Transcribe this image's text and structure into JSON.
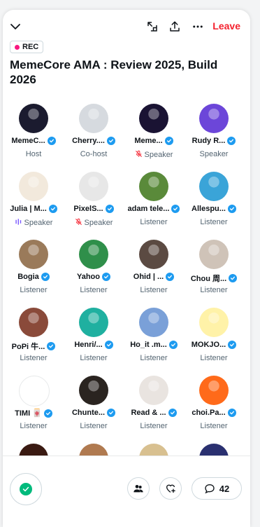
{
  "topbar": {
    "leave_label": "Leave",
    "icons": [
      "chevron-down-icon",
      "dock-icon",
      "share-icon",
      "more-icon"
    ]
  },
  "rec_label": "REC",
  "space_title": "MemeCore AMA : Review 2025, Build 2026",
  "participants": [
    {
      "name": "MemeC...",
      "role": "Host",
      "mic": "none",
      "avatar_color": "#1b1b2f"
    },
    {
      "name": "Cherry....",
      "role": "Co-host",
      "mic": "none",
      "avatar_color": "#d6dadf"
    },
    {
      "name": "Meme...",
      "role": "Speaker",
      "mic": "muted",
      "avatar_color": "#1a1333"
    },
    {
      "name": "Rudy R...",
      "role": "Speaker",
      "mic": "none",
      "avatar_color": "#6c46d9"
    },
    {
      "name": "Julia | M...",
      "role": "Speaker",
      "mic": "speaking",
      "avatar_color": "#f2e9dc"
    },
    {
      "name": "PixelS...",
      "role": "Speaker",
      "mic": "muted",
      "avatar_color": "#e7e7e7"
    },
    {
      "name": "adam tele...",
      "role": "Listener",
      "mic": "none",
      "avatar_color": "#5a8a3a"
    },
    {
      "name": "Allespu...",
      "role": "Listener",
      "mic": "none",
      "avatar_color": "#3aa4d8"
    },
    {
      "name": "Bogia",
      "role": "Listener",
      "mic": "none",
      "avatar_color": "#9a7a5a"
    },
    {
      "name": "Yahoo",
      "role": "Listener",
      "mic": "none",
      "avatar_color": "#2f8f4a"
    },
    {
      "name": "Ohid | ...",
      "role": "Listener",
      "mic": "none",
      "avatar_color": "#5b4a42"
    },
    {
      "name": "Chou 周...",
      "role": "Listener",
      "mic": "none",
      "avatar_color": "#cfc3b8"
    },
    {
      "name": "PoPi 牛...",
      "role": "Listener",
      "mic": "none",
      "avatar_color": "#8a4a3a"
    },
    {
      "name": "Henri/...",
      "role": "Listener",
      "mic": "none",
      "avatar_color": "#1fb0a0"
    },
    {
      "name": "Ho_it .m...",
      "role": "Listener",
      "mic": "none",
      "avatar_color": "#7aa0d8"
    },
    {
      "name": "MOKJO...",
      "role": "Listener",
      "mic": "none",
      "avatar_color": "#fff2a8"
    },
    {
      "name": "TIMI 🀄",
      "role": "Listener",
      "mic": "none",
      "avatar_color": "#ffffff"
    },
    {
      "name": "Chunte...",
      "role": "Listener",
      "mic": "none",
      "avatar_color": "#2a2420"
    },
    {
      "name": "Read & ...",
      "role": "Listener",
      "mic": "none",
      "avatar_color": "#e9e4e0"
    },
    {
      "name": "choi.Pa...",
      "role": "Listener",
      "mic": "none",
      "avatar_color": "#ff6a1a"
    }
  ],
  "bottom": {
    "comment_count": "42",
    "icons": [
      "mic-status-icon",
      "people-icon",
      "add-heart-icon",
      "comment-icon"
    ]
  },
  "colors": {
    "accent": "#1d9bf0",
    "leave": "#f4212e",
    "rec_dot": "#f91880",
    "mic_green": "#00ba7c",
    "speaking": "#7856ff",
    "muted": "#f4212e"
  }
}
